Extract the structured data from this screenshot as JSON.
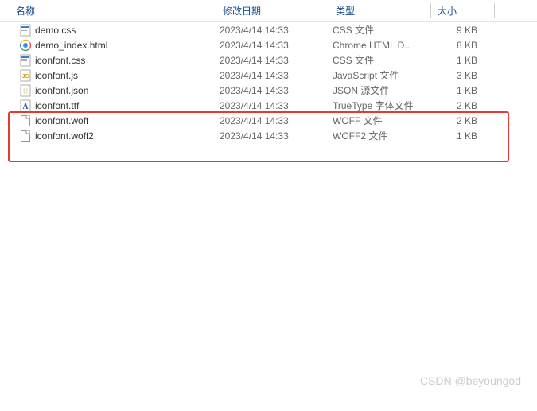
{
  "columns": {
    "name": "名称",
    "date": "修改日期",
    "type": "类型",
    "size": "大小"
  },
  "files": [
    {
      "name": "demo.css",
      "date": "2023/4/14 14:33",
      "type": "CSS 文件",
      "size": "9 KB",
      "icon": "css"
    },
    {
      "name": "demo_index.html",
      "date": "2023/4/14 14:33",
      "type": "Chrome HTML D...",
      "size": "8 KB",
      "icon": "html"
    },
    {
      "name": "iconfont.css",
      "date": "2023/4/14 14:33",
      "type": "CSS 文件",
      "size": "1 KB",
      "icon": "css"
    },
    {
      "name": "iconfont.js",
      "date": "2023/4/14 14:33",
      "type": "JavaScript 文件",
      "size": "3 KB",
      "icon": "js"
    },
    {
      "name": "iconfont.json",
      "date": "2023/4/14 14:33",
      "type": "JSON 源文件",
      "size": "1 KB",
      "icon": "json"
    },
    {
      "name": "iconfont.ttf",
      "date": "2023/4/14 14:33",
      "type": "TrueType 字体文件",
      "size": "2 KB",
      "icon": "font"
    },
    {
      "name": "iconfont.woff",
      "date": "2023/4/14 14:33",
      "type": "WOFF 文件",
      "size": "2 KB",
      "icon": "generic"
    },
    {
      "name": "iconfont.woff2",
      "date": "2023/4/14 14:33",
      "type": "WOFF2 文件",
      "size": "1 KB",
      "icon": "generic"
    }
  ],
  "watermark": "CSDN @beyoungod"
}
